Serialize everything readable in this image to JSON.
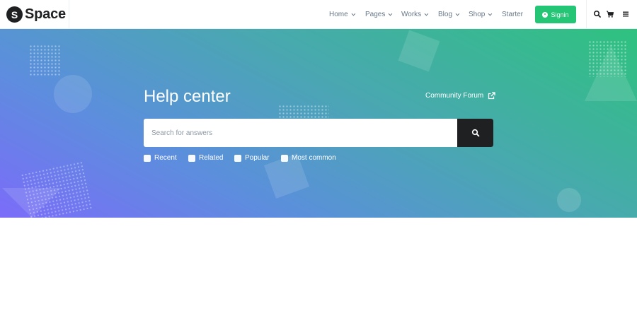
{
  "brand": {
    "mark": "S",
    "name": "Space"
  },
  "nav": {
    "items": [
      {
        "label": "Home",
        "has_dropdown": true
      },
      {
        "label": "Pages",
        "has_dropdown": true
      },
      {
        "label": "Works",
        "has_dropdown": true
      },
      {
        "label": "Blog",
        "has_dropdown": true
      },
      {
        "label": "Shop",
        "has_dropdown": true
      },
      {
        "label": "Starter",
        "has_dropdown": false
      }
    ],
    "signin_label": "Signin",
    "icons": [
      "search-icon",
      "cart-icon",
      "menu-icon"
    ]
  },
  "hero": {
    "title": "Help center",
    "forum_link": "Community Forum",
    "search": {
      "placeholder": "Search for answers",
      "value": ""
    },
    "filters": [
      {
        "label": "Recent",
        "checked": false
      },
      {
        "label": "Related",
        "checked": false
      },
      {
        "label": "Popular",
        "checked": false
      },
      {
        "label": "Most common",
        "checked": false
      }
    ]
  },
  "colors": {
    "accent_green": "#25c576",
    "dark": "#1e2022",
    "gradient_start": "#7b6cf9",
    "gradient_end": "#2ec27f"
  }
}
